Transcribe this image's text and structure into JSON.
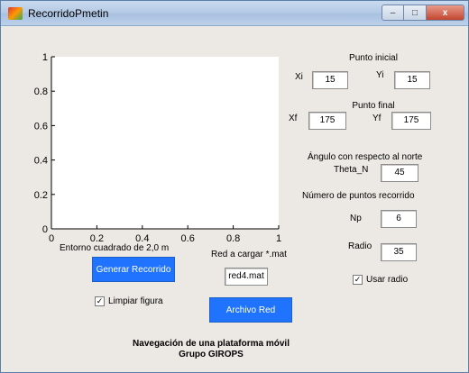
{
  "window": {
    "title": "RecorridoPmetin",
    "minimize_glyph": "–",
    "maximize_glyph": "□",
    "close_glyph": "x"
  },
  "chart_data": {
    "type": "scatter",
    "xlim": [
      0,
      1
    ],
    "ylim": [
      0,
      1
    ],
    "x_ticks": [
      "0",
      "0.2",
      "0.4",
      "0.6",
      "0.8",
      "1"
    ],
    "y_ticks": [
      "0",
      "0.2",
      "0.4",
      "0.6",
      "0.8",
      "1"
    ],
    "xlabel": "Entorno cuadrado de 2,0 m",
    "ylabel": "",
    "title": "",
    "series": [],
    "grid": false
  },
  "controls": {
    "punto_inicial": {
      "label": "Punto inicial",
      "xi_label": "Xi",
      "xi_value": "15",
      "yi_label": "Yi",
      "yi_value": "15"
    },
    "punto_final": {
      "label": "Punto final",
      "xf_label": "Xf",
      "xf_value": "175",
      "yf_label": "Yf",
      "yf_value": "175"
    },
    "angulo": {
      "label": "Ángulo con respecto al norte",
      "theta_label": "Theta_N",
      "theta_value": "45"
    },
    "puntos": {
      "label": "Número de puntos recorrido",
      "np_label": "Np",
      "np_value": "6"
    },
    "radio": {
      "label": "Radio",
      "value": "35",
      "usar_radio_label": "Usar radio",
      "usar_radio_checked": true
    },
    "red": {
      "label": "Red a cargar *.mat",
      "value": "red4.mat"
    },
    "generar_button": "Generar Recorrido",
    "archivo_button": "Archivo Red",
    "limpiar": {
      "label": "Limpiar figura",
      "checked": true
    }
  },
  "footer": {
    "line1": "Navegación de una plataforma móvil",
    "line2": "Grupo GIROPS"
  },
  "colors": {
    "button_blue": "#1f73ff",
    "panel_bg": "#ece9e4"
  }
}
